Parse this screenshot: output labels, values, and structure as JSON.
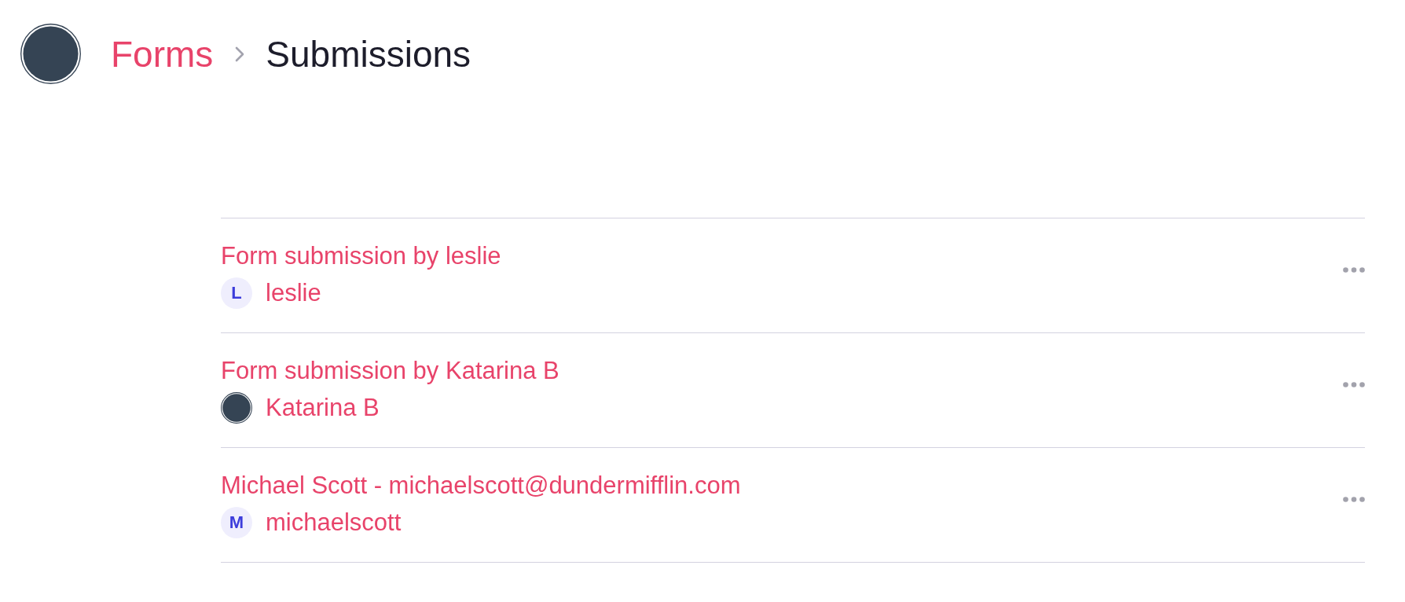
{
  "breadcrumb": [
    {
      "label": "Forms",
      "kind": "link"
    },
    {
      "label": "Submissions",
      "kind": "current"
    }
  ],
  "submissions": [
    {
      "title": "Form submission by leslie",
      "avatar": {
        "kind": "initial",
        "initial": "L"
      },
      "name": "leslie"
    },
    {
      "title": "Form submission by Katarina B",
      "avatar": {
        "kind": "image"
      },
      "name": "Katarina B"
    },
    {
      "title": "Michael Scott - michaelscott@dundermifflin.com",
      "avatar": {
        "kind": "initial",
        "initial": "M"
      },
      "name": "michaelscott"
    }
  ]
}
